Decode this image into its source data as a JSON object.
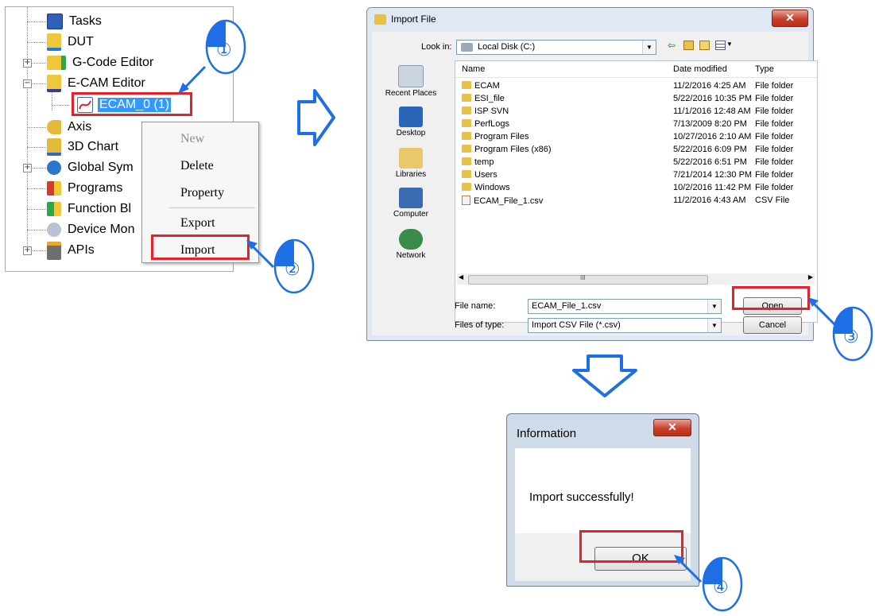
{
  "tree": {
    "items": [
      {
        "label": "Tasks"
      },
      {
        "label": "DUT"
      },
      {
        "label": "G-Code Editor"
      },
      {
        "label": "E-CAM Editor"
      },
      {
        "label": "ECAM_0 (1)"
      },
      {
        "label": "Axis"
      },
      {
        "label": "3D Chart"
      },
      {
        "label": "Global Sym"
      },
      {
        "label": "Programs"
      },
      {
        "label": "Function Bl"
      },
      {
        "label": "Device Mon"
      },
      {
        "label": "APIs"
      }
    ]
  },
  "context_menu": {
    "items": [
      "New",
      "Delete",
      "Property",
      "Export",
      "Import"
    ]
  },
  "steps": [
    "①",
    "②",
    "③",
    "④"
  ],
  "import_dialog": {
    "title": "Import File",
    "look_in_label": "Look in:",
    "look_in_value": "Local Disk (C:)",
    "places": [
      "Recent Places",
      "Desktop",
      "Libraries",
      "Computer",
      "Network"
    ],
    "columns": {
      "name": "Name",
      "date": "Date modified",
      "type": "Type"
    },
    "files": [
      {
        "name": "ECAM",
        "date": "11/2/2016 4:25 AM",
        "type": "File folder"
      },
      {
        "name": "ESI_file",
        "date": "5/22/2016 10:35 PM",
        "type": "File folder"
      },
      {
        "name": "ISP SVN",
        "date": "11/1/2016 12:48 AM",
        "type": "File folder"
      },
      {
        "name": "PerfLogs",
        "date": "7/13/2009 8:20 PM",
        "type": "File folder"
      },
      {
        "name": "Program Files",
        "date": "10/27/2016 2:10 AM",
        "type": "File folder"
      },
      {
        "name": "Program Files (x86)",
        "date": "5/22/2016 6:09 PM",
        "type": "File folder"
      },
      {
        "name": "temp",
        "date": "5/22/2016 6:51 PM",
        "type": "File folder"
      },
      {
        "name": "Users",
        "date": "7/21/2014 12:30 PM",
        "type": "File folder"
      },
      {
        "name": "Windows",
        "date": "10/2/2016 11:42 PM",
        "type": "File folder"
      },
      {
        "name": "ECAM_File_1.csv",
        "date": "11/2/2016 4:43 AM",
        "type": "CSV File"
      }
    ],
    "file_name_label": "File name:",
    "file_name_value": "ECAM_File_1.csv",
    "file_type_label": "Files of type:",
    "file_type_value": "Import CSV File (*.csv)",
    "open_label": "Open",
    "cancel_label": "Cancel",
    "scroll_marker": "III"
  },
  "info_dialog": {
    "title": "Information",
    "message": "Import successfully!",
    "ok_label": "OK"
  },
  "colors": {
    "highlight": "#e8202a",
    "flow_arrow": "#1e6fe6",
    "selection": "#3399ff"
  }
}
